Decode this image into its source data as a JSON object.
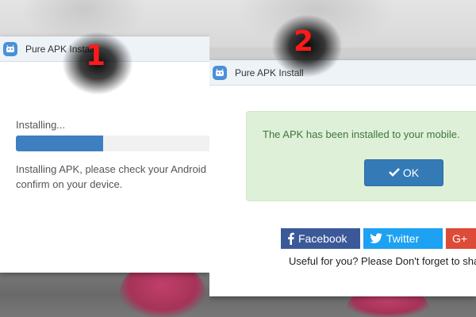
{
  "step1": {
    "number": "1",
    "dialog_title": "Pure APK Install",
    "status": "Installing...",
    "progress": 0.45,
    "message": "Installing APK, please check your Android and confirm on your device."
  },
  "step2": {
    "number": "2",
    "dialog_title": "Pure APK Install",
    "success_message": "The APK has been installed to your mobile.",
    "ok_label": "OK",
    "share": {
      "facebook_label": "Facebook",
      "twitter_label": "Twitter",
      "googleplus_label": "G+"
    },
    "footer": "Useful for you? Please Don't forget to share!"
  },
  "colors": {
    "progress_fill": "#3f7fbf",
    "ok_button": "#337ab7",
    "success_bg": "#dff0d8",
    "success_text": "#3c763d",
    "facebook": "#3b5998",
    "twitter": "#1da1f2",
    "googleplus": "#dd4b39",
    "step_number": "#ff1a1a"
  },
  "icons": [
    "android-app-icon",
    "check-icon",
    "facebook-icon",
    "twitter-icon",
    "googleplus-icon"
  ]
}
